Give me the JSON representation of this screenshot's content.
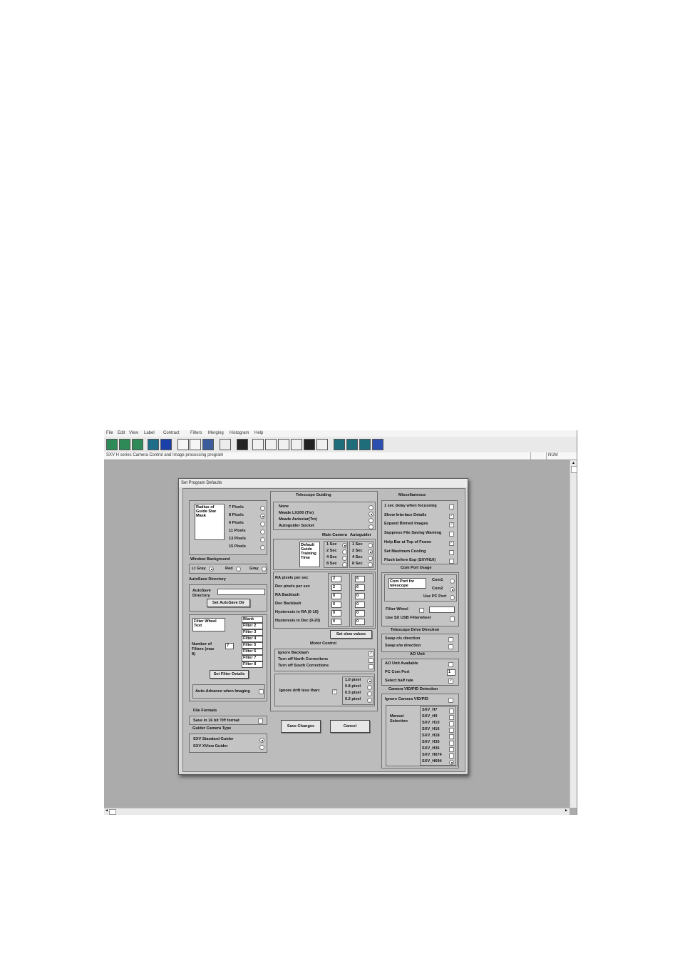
{
  "menu": [
    "File",
    "Edit",
    "View",
    "Label",
    "Contract",
    "Filters",
    "Merging",
    "Histogram",
    "Help"
  ],
  "status": {
    "title": "SXV H series Camera Control and Image processing program",
    "num": "NUM"
  },
  "dialog": {
    "title": "Set Program Defaults",
    "radius": {
      "label": "Radius of Guide Star Mask",
      "options": [
        "7 Pixels",
        "8 Pixels",
        "9 Pixels",
        "11 Pixels",
        "13 Pixels",
        "15 Pixels"
      ],
      "selected": 1
    },
    "window_bg": {
      "heading": "Window Background",
      "options": [
        "Lt Gray",
        "Red",
        "Gray"
      ],
      "selected": 0
    },
    "autosave": {
      "heading": "AutoSave Directory",
      "label": "AutoSave Directory",
      "value": "",
      "button": "Set AutoSave Dir"
    },
    "filter_wheel": {
      "label": "Filter Wheel Text",
      "num_label": "Number of Filters (max 8)",
      "num_value": "7",
      "names": [
        "Blank",
        "Filter 2",
        "Filter 3",
        "Filter 4",
        "Filter 5",
        "Filter 6",
        "Filter 7",
        "Filter 8"
      ],
      "button": "Set Filter Details",
      "auto_advance": "Auto-Advance when Imaging"
    },
    "file_formats": {
      "heading": "File Formats",
      "tiff": "Save in 16 bit Tiff format"
    },
    "guider_type": {
      "heading": "Guider Camera Type",
      "options": [
        "SXV Standard Guider",
        "SXV XView Guider"
      ],
      "selected": 0
    },
    "guiding": {
      "heading": "Telescope Guiding",
      "options": [
        "None",
        "Meade LX200 (Tm)",
        "Meade Autostar(Tm)",
        "Autoguider Socket"
      ],
      "selected": 1,
      "col_main": "Main Camera",
      "col_auto": "Autoguider",
      "training_label": "Default Guide Training Time",
      "times": [
        "1 Sec",
        "2 Sec",
        "4 Sec",
        "8 Sec"
      ],
      "main_selected": 0,
      "auto_selected": 1,
      "params": [
        {
          "label": "RA pixels per sec",
          "main": "2",
          "auto": "6"
        },
        {
          "label": "Dec pixels per sec",
          "main": "2",
          "auto": "6"
        },
        {
          "label": "RA Backlash",
          "main": "0",
          "auto": "0"
        },
        {
          "label": "Dec Backlash",
          "main": "0",
          "auto": "0"
        },
        {
          "label": "Hysteresis in RA (0-10)",
          "main": "0",
          "auto": "0"
        },
        {
          "label": "Hysteresis in Dec (0-20)",
          "main": "0",
          "auto": "0"
        }
      ],
      "slew_button": "Set slew values"
    },
    "motor": {
      "heading": "Motor Control",
      "items": [
        {
          "label": "Ignore Backlash",
          "checked": true
        },
        {
          "label": "Turn off North Corrections",
          "checked": false
        },
        {
          "label": "Turn off South Corrections",
          "checked": false
        }
      ],
      "drift_label": "Ignore drift less than:",
      "drift_opts": [
        "1.0 pixel",
        "0.8 pixel",
        "0.5 pixel",
        "0.2 pixel"
      ],
      "drift_selected": 0
    },
    "save_button": "Save Changes",
    "cancel_button": "Cancel",
    "misc": {
      "heading": "Miscellaneous",
      "items": [
        {
          "label": "1 sec delay when focussing",
          "checked": false
        },
        {
          "label": "Show Interlace Details",
          "checked": true
        },
        {
          "label": "Expand Binned Images",
          "checked": true
        },
        {
          "label": "Suppress File Saving Warning",
          "checked": false
        },
        {
          "label": "Help Bar at Top of Frame",
          "checked": true
        },
        {
          "label": "Set Maximum Cooling",
          "checked": false
        },
        {
          "label": "Flush before Exp (SXVH16)",
          "checked": false
        }
      ]
    },
    "comport": {
      "heading": "Com Port Usage",
      "label": "Com Port for telescope",
      "options": [
        "Com1",
        "Com2",
        "Use PC Port"
      ],
      "selected": 1,
      "filter_wheel": "Filter Wheel",
      "usb_fw": "Use SX USB Filterwheel"
    },
    "drive": {
      "heading": "Telescope Drive Direction",
      "items": [
        "Swap n/s direction",
        "Swap e/w direction"
      ]
    },
    "ao": {
      "heading": "AO Unit",
      "available": "AO Unit Available",
      "port_label": "PC Com Port",
      "port_value": "1",
      "half_rate": "Select half rate"
    },
    "vidpid": {
      "heading": "Camera VID/PID Detection",
      "ignore": "Ignore Camera VID/PID",
      "manual": "Manual Selection",
      "cams": [
        "SXV_H7",
        "SXV_H9",
        "SXV_H10",
        "SXV_H16",
        "SXV_H18",
        "SXV_H35",
        "SXV_H36",
        "SXV_H674",
        "SXV_H694"
      ],
      "selected": 8
    }
  }
}
